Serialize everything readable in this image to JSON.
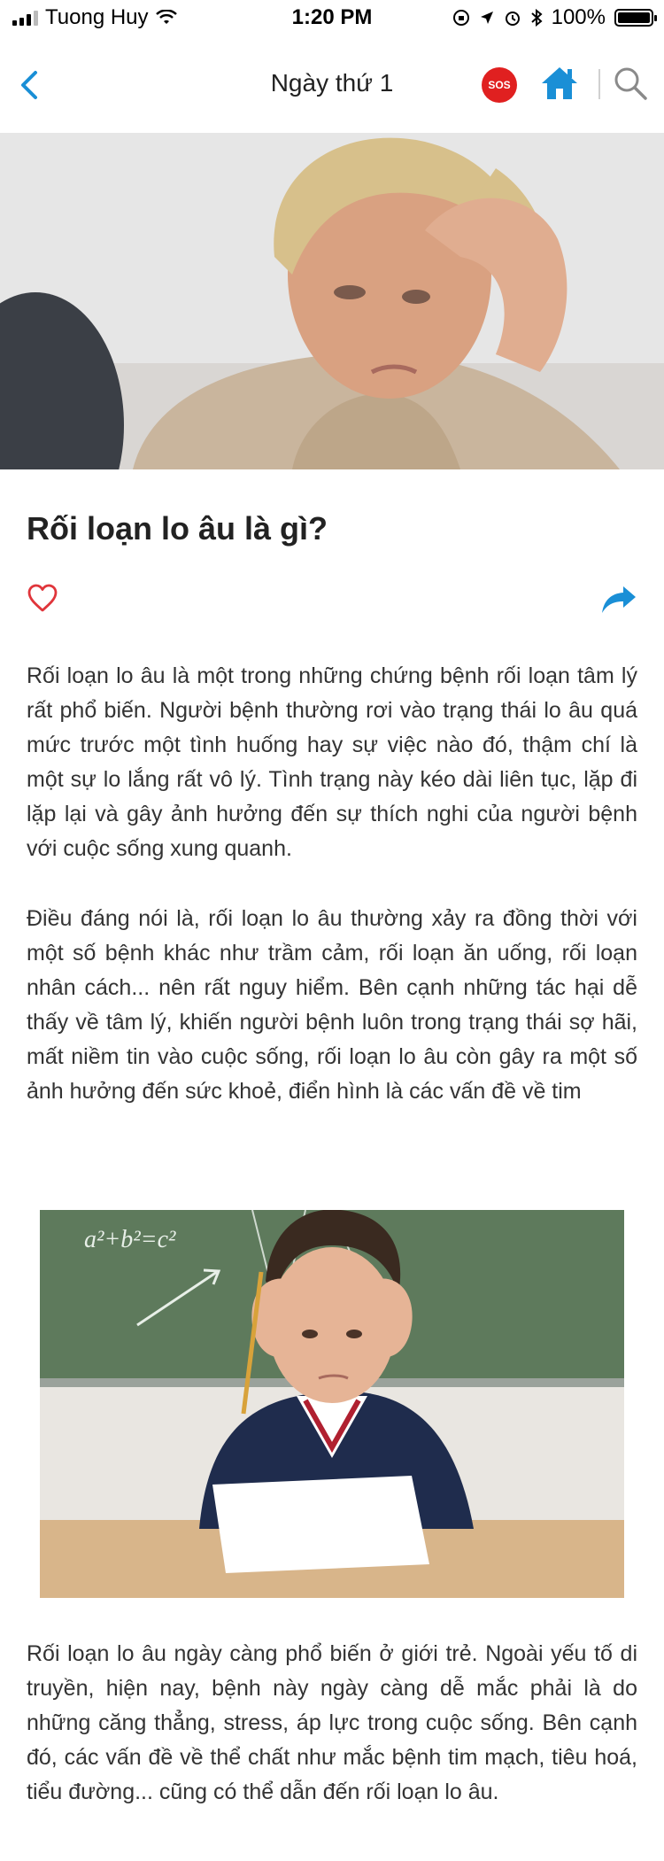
{
  "status_bar": {
    "carrier": "Tuong Huy",
    "time": "1:20 PM",
    "battery": "100%"
  },
  "header": {
    "title": "Ngày thứ 1",
    "sos_label": "SOS"
  },
  "colors": {
    "accent": "#1a8fd6",
    "sos": "#e02020",
    "like": "#e0353b"
  },
  "article": {
    "title": "Rối loạn lo âu là gì?",
    "paragraph_1": "Rối loạn lo âu là một trong những chứng bệnh rối loạn tâm lý rất phổ biến. Người bệnh thường rơi vào trạng thái lo âu quá mức trước một tình huống hay sự việc nào đó, thậm chí là một sự lo lắng rất vô lý. Tình trạng này kéo dài liên tục, lặp đi lặp lại và gây ảnh hưởng đến sự thích nghi của người bệnh với cuộc sống xung quanh.",
    "paragraph_2": "Điều đáng nói là, rối loạn lo âu thường xảy ra đồng thời với một số bệnh khác như trầm cảm, rối loạn ăn uống, rối loạn nhân cách... nên rất nguy hiểm. Bên cạnh những tác hại dễ thấy về tâm lý, khiến người bệnh luôn trong trạng thái sợ hãi, mất niềm tin vào cuộc sống, rối loạn lo âu còn gây ra một số ảnh hưởng đến sức khoẻ, điển hình là các vấn đề về tim",
    "paragraph_3": "Rối loạn lo âu ngày càng phổ biến ở giới trẻ. Ngoài yếu tố di truyền, hiện nay, bệnh này ngày càng dễ mắc phải là do những căng thẳng, stress, áp lực trong cuộc sống. Bên cạnh đó, các vấn đề về thể chất như mắc bệnh tim mạch, tiêu hoá, tiểu đường... cũng có thể dẫn đến rối loạn lo âu.",
    "chalkboard_text": "a²+b²=c²"
  },
  "icons": {
    "back": "chevron-left-icon",
    "home": "home-icon",
    "search": "search-icon",
    "like": "heart-outline-icon",
    "share": "share-arrow-icon"
  }
}
